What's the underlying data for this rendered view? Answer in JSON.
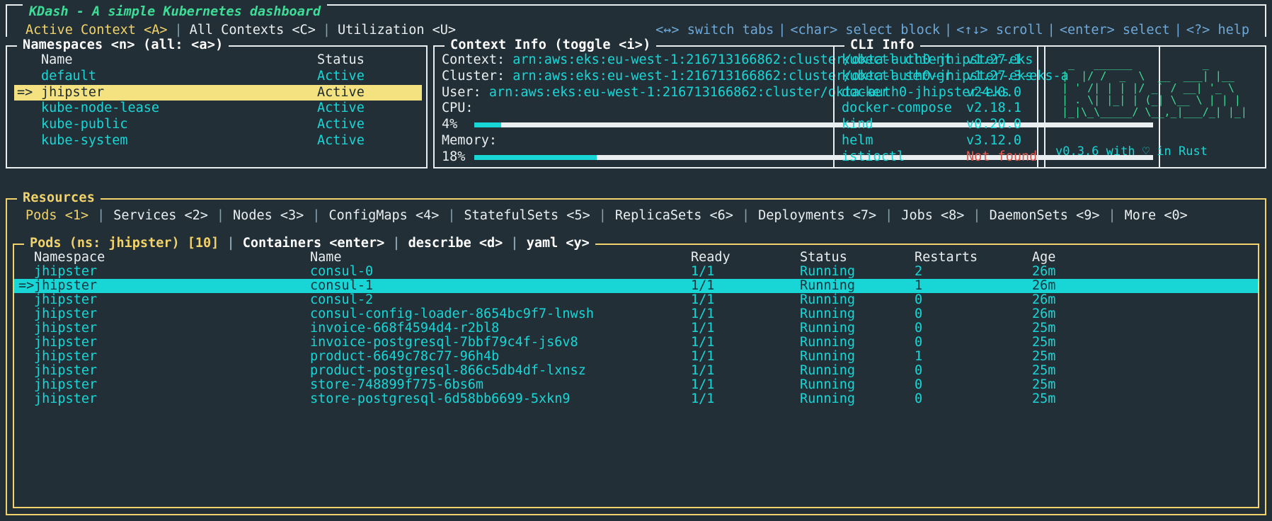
{
  "app": {
    "title": "KDash - A simple Kubernetes dashboard",
    "tabs": [
      {
        "label": "Active Context <A>",
        "active": true
      },
      {
        "label": "All Contexts <C>",
        "active": false
      },
      {
        "label": "Utilization <U>",
        "active": false
      }
    ],
    "help": [
      "<↔> switch tabs",
      "<char> select block",
      "<↑↓> scroll",
      "<enter> select",
      "<?> help"
    ]
  },
  "namespaces": {
    "title": "Namespaces <n> (all: <a>)",
    "columns": [
      "Name",
      "Status"
    ],
    "rows": [
      {
        "arrow": "",
        "name": "default",
        "status": "Active",
        "selected": false
      },
      {
        "arrow": "=>",
        "name": "jhipster",
        "status": "Active",
        "selected": true
      },
      {
        "arrow": "",
        "name": "kube-node-lease",
        "status": "Active",
        "selected": false
      },
      {
        "arrow": "",
        "name": "kube-public",
        "status": "Active",
        "selected": false
      },
      {
        "arrow": "",
        "name": "kube-system",
        "status": "Active",
        "selected": false
      }
    ]
  },
  "context_info": {
    "title": "Context Info (toggle <i>)",
    "context_label": "Context:",
    "context_value": "arn:aws:eks:eu-west-1:216713166862:cluster/okta-auth0-jhipster-eks",
    "cluster_label": "Cluster:",
    "cluster_value": "arn:aws:eks:eu-west-1:216713166862:cluster/okta-auth0-jhipster-eks",
    "user_label": "User:",
    "user_value": "arn:aws:eks:eu-west-1:216713166862:cluster/okta-auth0-jhipster-eks",
    "cpu_label": "CPU:",
    "cpu_pct_text": "4%",
    "cpu_pct": 4,
    "memory_label": "Memory:",
    "memory_pct_text": "18%",
    "memory_pct": 18
  },
  "cli_info": {
    "title": "CLI Info",
    "rows": [
      {
        "name": "kubectl client",
        "version": "v1.27.1",
        "missing": false
      },
      {
        "name": "kubectl server",
        "version": "v1.27.3-eks-a",
        "missing": false
      },
      {
        "name": "docker",
        "version": "v24.0.0",
        "missing": false
      },
      {
        "name": "docker-compose",
        "version": "v2.18.1",
        "missing": false
      },
      {
        "name": "kind",
        "version": "v0.20.0",
        "missing": false
      },
      {
        "name": "helm",
        "version": "v3.12.0",
        "missing": false
      },
      {
        "name": "istioctl",
        "version": "Not found",
        "missing": true
      }
    ]
  },
  "logo": {
    "ascii": "  _   ______           _\n |  |/ /  _  \\  __  ___| |__\n | ' /| | | |/ _` / __| '_ \\\n | . \\| |_| | (_| \\__ \\ | | |\n |_|\\_\\_____/ \\__,_|___/_| |_|",
    "version_line": "v0.3.6 with ♡ in Rust"
  },
  "resources": {
    "title": "Resources",
    "tabs": [
      {
        "label": "Pods <1>",
        "active": true
      },
      {
        "label": "Services <2>",
        "active": false
      },
      {
        "label": "Nodes <3>",
        "active": false
      },
      {
        "label": "ConfigMaps <4>",
        "active": false
      },
      {
        "label": "StatefulSets <5>",
        "active": false
      },
      {
        "label": "ReplicaSets <6>",
        "active": false
      },
      {
        "label": "Deployments <7>",
        "active": false
      },
      {
        "label": "Jobs <8>",
        "active": false
      },
      {
        "label": "DaemonSets <9>",
        "active": false
      },
      {
        "label": "More <0>",
        "active": false
      }
    ]
  },
  "pods": {
    "title_main": "Pods (ns: jhipster) [10]",
    "title_actions": [
      "Containers <enter>",
      "describe <d>",
      "yaml <y>"
    ],
    "columns": [
      "Namespace",
      "Name",
      "Ready",
      "Status",
      "Restarts",
      "Age"
    ],
    "rows": [
      {
        "arrow": "",
        "namespace": "jhipster",
        "name": "consul-0",
        "ready": "1/1",
        "status": "Running",
        "restarts": "2",
        "age": "26m",
        "selected": false
      },
      {
        "arrow": "=>",
        "namespace": "jhipster",
        "name": "consul-1",
        "ready": "1/1",
        "status": "Running",
        "restarts": "1",
        "age": "26m",
        "selected": true
      },
      {
        "arrow": "",
        "namespace": "jhipster",
        "name": "consul-2",
        "ready": "1/1",
        "status": "Running",
        "restarts": "0",
        "age": "26m",
        "selected": false
      },
      {
        "arrow": "",
        "namespace": "jhipster",
        "name": "consul-config-loader-8654bc9f7-lnwsh",
        "ready": "1/1",
        "status": "Running",
        "restarts": "0",
        "age": "26m",
        "selected": false
      },
      {
        "arrow": "",
        "namespace": "jhipster",
        "name": "invoice-668f4594d4-r2bl8",
        "ready": "1/1",
        "status": "Running",
        "restarts": "0",
        "age": "25m",
        "selected": false
      },
      {
        "arrow": "",
        "namespace": "jhipster",
        "name": "invoice-postgresql-7bbf79c4f-js6v8",
        "ready": "1/1",
        "status": "Running",
        "restarts": "0",
        "age": "25m",
        "selected": false
      },
      {
        "arrow": "",
        "namespace": "jhipster",
        "name": "product-6649c78c77-96h4b",
        "ready": "1/1",
        "status": "Running",
        "restarts": "1",
        "age": "25m",
        "selected": false
      },
      {
        "arrow": "",
        "namespace": "jhipster",
        "name": "product-postgresql-866c5db4df-lxnsz",
        "ready": "1/1",
        "status": "Running",
        "restarts": "0",
        "age": "25m",
        "selected": false
      },
      {
        "arrow": "",
        "namespace": "jhipster",
        "name": "store-748899f775-6bs6m",
        "ready": "1/1",
        "status": "Running",
        "restarts": "0",
        "age": "25m",
        "selected": false
      },
      {
        "arrow": "",
        "namespace": "jhipster",
        "name": "store-postgresql-6d58bb6699-5xkn9",
        "ready": "1/1",
        "status": "Running",
        "restarts": "0",
        "age": "25m",
        "selected": false
      }
    ]
  },
  "colors": {
    "background": "#222f36",
    "border": "#e9eef1",
    "accent_yellow": "#f2d36b",
    "accent_cyan": "#19d6d6",
    "accent_green": "#3ddc97",
    "help_blue": "#6ea8d8",
    "error_red": "#e0564b"
  }
}
